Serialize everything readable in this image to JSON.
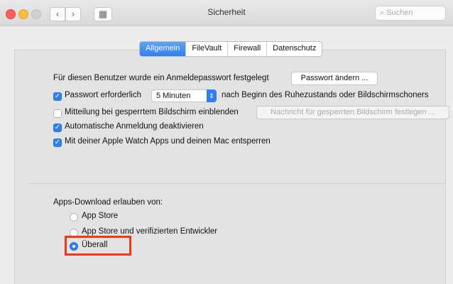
{
  "window": {
    "title": "Sicherheit",
    "search_placeholder": "Suchen"
  },
  "toolbar": {
    "back": "‹",
    "forward": "›",
    "grid": "▦",
    "search_icon": "⌕"
  },
  "tabs": [
    {
      "label": "Allgemein",
      "active": true
    },
    {
      "label": "FileVault",
      "active": false
    },
    {
      "label": "Firewall",
      "active": false
    },
    {
      "label": "Datenschutz",
      "active": false
    }
  ],
  "general": {
    "password_set_text": "Für diesen Benutzer wurde ein Anmeldepasswort festgelegt",
    "change_password_button": "Passwort ändern ...",
    "require_password_label": "Passwort erforderlich",
    "require_password_value": "5 Minuten",
    "require_password_suffix": "nach Beginn des Ruhezustands oder Bildschirmschoners",
    "show_message_label": "Mitteilung bei gesperrtem Bildschirm einblenden",
    "set_message_button": "Nachricht für gesperrten Bildschirm festlegen ...",
    "disable_autologin_label": "Automatische Anmeldung deaktivieren",
    "apple_watch_label": "Mit deiner Apple Watch Apps und deinen Mac entsperren",
    "checked": {
      "require_password": true,
      "show_message": false,
      "disable_autologin": true,
      "apple_watch": true
    }
  },
  "downloads": {
    "heading": "Apps-Download erlauben von:",
    "options": [
      "App Store",
      "App Store und verifizierten Entwickler",
      "Überall"
    ],
    "selected": "Überall"
  },
  "colors": {
    "accent": "#2f7ff1",
    "highlight": "#f2361b"
  }
}
